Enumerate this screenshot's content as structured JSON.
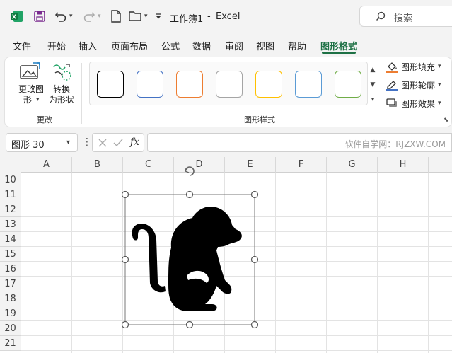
{
  "app": {
    "title": "工作簿1",
    "separator": "-",
    "app_name": "Excel",
    "search_placeholder": "搜索"
  },
  "tabs": [
    {
      "label": "文件"
    },
    {
      "label": "开始"
    },
    {
      "label": "插入"
    },
    {
      "label": "页面布局"
    },
    {
      "label": "公式"
    },
    {
      "label": "数据"
    },
    {
      "label": "审阅"
    },
    {
      "label": "视图"
    },
    {
      "label": "帮助"
    },
    {
      "label": "图形格式",
      "active": true
    }
  ],
  "ribbon": {
    "change_group": {
      "label": "更改",
      "edit_shape_line1": "更改图",
      "edit_shape_line2": "形",
      "convert_line1": "转换",
      "convert_line2": "为形状"
    },
    "styles_group": {
      "label": "图形样式",
      "swatch_colors": [
        "#000000",
        "#4472c4",
        "#ed7d31",
        "#a5a5a5",
        "#ffc000",
        "#5b9bd5",
        "#70ad47"
      ]
    },
    "fill_label": "图形填充",
    "outline_label": "图形轮廓",
    "effects_label": "图形效果",
    "accent_colors": {
      "fill": "#ed7d31",
      "outline": "#4472c4"
    }
  },
  "formula_bar": {
    "name_box": "图形 30",
    "fx": "fx",
    "watermark": "软件自学网：RJZXW.COM"
  },
  "grid": {
    "columns": [
      "A",
      "B",
      "C",
      "D",
      "E",
      "F",
      "G",
      "H"
    ],
    "rows": [
      "10",
      "11",
      "12",
      "13",
      "14",
      "15",
      "16",
      "17",
      "18",
      "19",
      "20",
      "21"
    ]
  },
  "selected_shape": {
    "icon": "monkey-icon",
    "color": "#000000"
  }
}
